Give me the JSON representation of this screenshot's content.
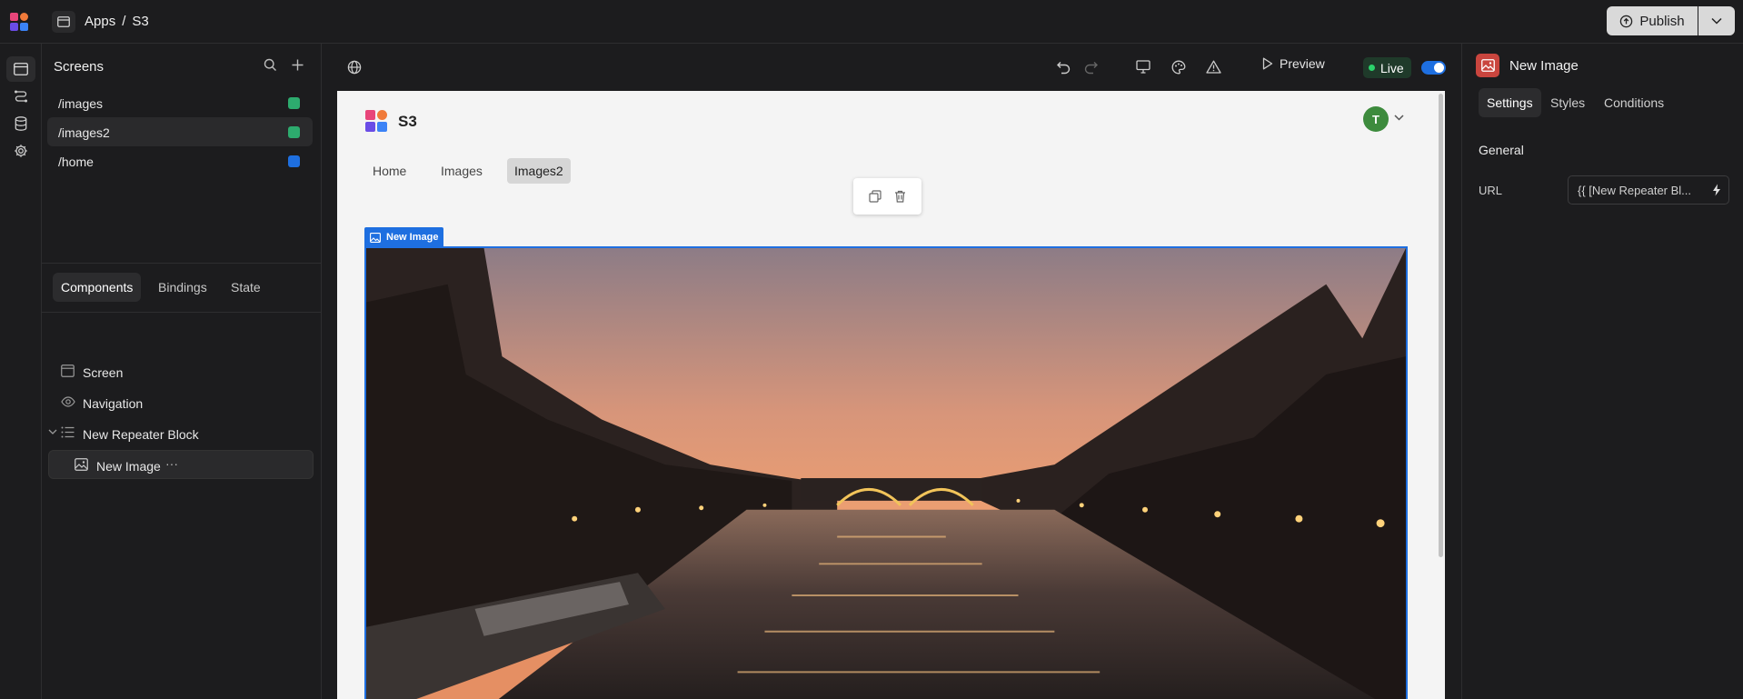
{
  "header": {
    "breadcrumb": [
      "Apps",
      "/",
      "S3"
    ],
    "publish_label": "Publish"
  },
  "screens_panel": {
    "title": "Screens",
    "items": [
      {
        "path": "/images",
        "color": "#2dab6e"
      },
      {
        "path": "/images2",
        "color": "#2dab6e"
      },
      {
        "path": "/home",
        "color": "#1e6fe0"
      }
    ],
    "selected": "/images2"
  },
  "component_tabs": [
    "Components",
    "Bindings",
    "State"
  ],
  "component_tree": [
    {
      "label": "Screen",
      "icon": "screen-icon"
    },
    {
      "label": "Navigation",
      "icon": "eye-icon"
    },
    {
      "label": "New Repeater Block",
      "icon": "list-icon"
    },
    {
      "label": "New Image",
      "icon": "image-icon",
      "more": "···"
    }
  ],
  "canvas_toolbar": {
    "preview_label": "Preview",
    "live_label": "Live"
  },
  "app_preview": {
    "name": "S3",
    "avatar_initial": "T",
    "nav_links": [
      "Home",
      "Images",
      "Images2"
    ],
    "active_link": "Images2",
    "selected_component_label": "New Image"
  },
  "settings_panel": {
    "title": "New Image",
    "tabs": [
      "Settings",
      "Styles",
      "Conditions"
    ],
    "section": "General",
    "url_label": "URL",
    "url_value": "{{ [New Repeater Bl..."
  },
  "colors": {
    "accent": "#1e6fe0",
    "live_green": "#2bd36b",
    "image_badge": "#c9453e"
  }
}
